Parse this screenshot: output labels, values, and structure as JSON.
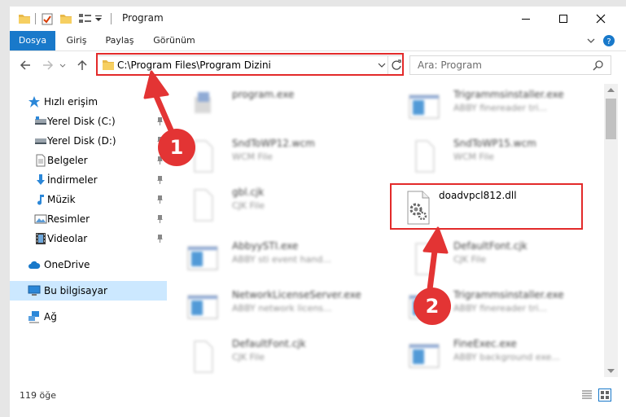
{
  "window": {
    "title": "Program"
  },
  "ribbon": {
    "tabs": [
      "Dosya",
      "Giriş",
      "Paylaş",
      "Görünüm"
    ]
  },
  "address": {
    "path": "C:\\Program Files\\Program Dizini"
  },
  "search": {
    "placeholder": "Ara: Program"
  },
  "sidebar": {
    "quick_access": "Hızlı erişim",
    "items": [
      {
        "label": "Yerel Disk (C:)",
        "icon": "drive-icon"
      },
      {
        "label": "Yerel Disk (D:)",
        "icon": "drive-icon"
      },
      {
        "label": "Belgeler",
        "icon": "documents-icon"
      },
      {
        "label": "İndirmeler",
        "icon": "downloads-icon"
      },
      {
        "label": "Müzik",
        "icon": "music-icon"
      },
      {
        "label": "Resimler",
        "icon": "pictures-icon"
      },
      {
        "label": "Videolar",
        "icon": "videos-icon"
      }
    ],
    "onedrive": "OneDrive",
    "this_pc": "Bu bilgisayar",
    "network": "Ağ"
  },
  "files": [
    {
      "name": "program.exe",
      "type": "",
      "icon": "setup-exe-icon",
      "blurred": true
    },
    {
      "name": "Trigrammsinstaller.exe",
      "type": "ABBY finereader tri...",
      "icon": "app-window-icon",
      "blurred": true
    },
    {
      "name": "SndToWP12.wcm",
      "type": "WCM File",
      "icon": "blank-file-icon",
      "blurred": true
    },
    {
      "name": "SndToWP15.wcm",
      "type": "WCM File",
      "icon": "blank-file-icon",
      "blurred": true
    },
    {
      "name": "gbl.cjk",
      "type": "CJK File",
      "icon": "blank-file-icon",
      "blurred": true
    },
    {
      "name": "doadvpcl812.dll",
      "type": "",
      "icon": "dll-gear-icon",
      "blurred": false
    },
    {
      "name": "AbbyySTI.exe",
      "type": "ABBY sti event hand...",
      "icon": "app-window-icon",
      "blurred": true
    },
    {
      "name": "DefaultFont.cjk",
      "type": "CJK File",
      "icon": "blank-file-icon",
      "blurred": true
    },
    {
      "name": "NetworkLicenseServer.exe",
      "type": "ABBY network licens...",
      "icon": "app-window-icon",
      "blurred": true
    },
    {
      "name": "Trigrammsinstaller.exe",
      "type": "ABBY finereader tri...",
      "icon": "app-window-icon",
      "blurred": true
    },
    {
      "name": "DefaultFont.cjk",
      "type": "CJK File",
      "icon": "blank-file-icon",
      "blurred": true
    },
    {
      "name": "FineExec.exe",
      "type": "ABBY background exe...",
      "icon": "app-window-icon",
      "blurred": true
    }
  ],
  "status": {
    "count": "119 öğe"
  },
  "annotations": {
    "step1": "1",
    "step2": "2"
  },
  "colors": {
    "accent": "#1979ca",
    "highlight": "#e32a2a",
    "selection": "#cce8ff"
  }
}
